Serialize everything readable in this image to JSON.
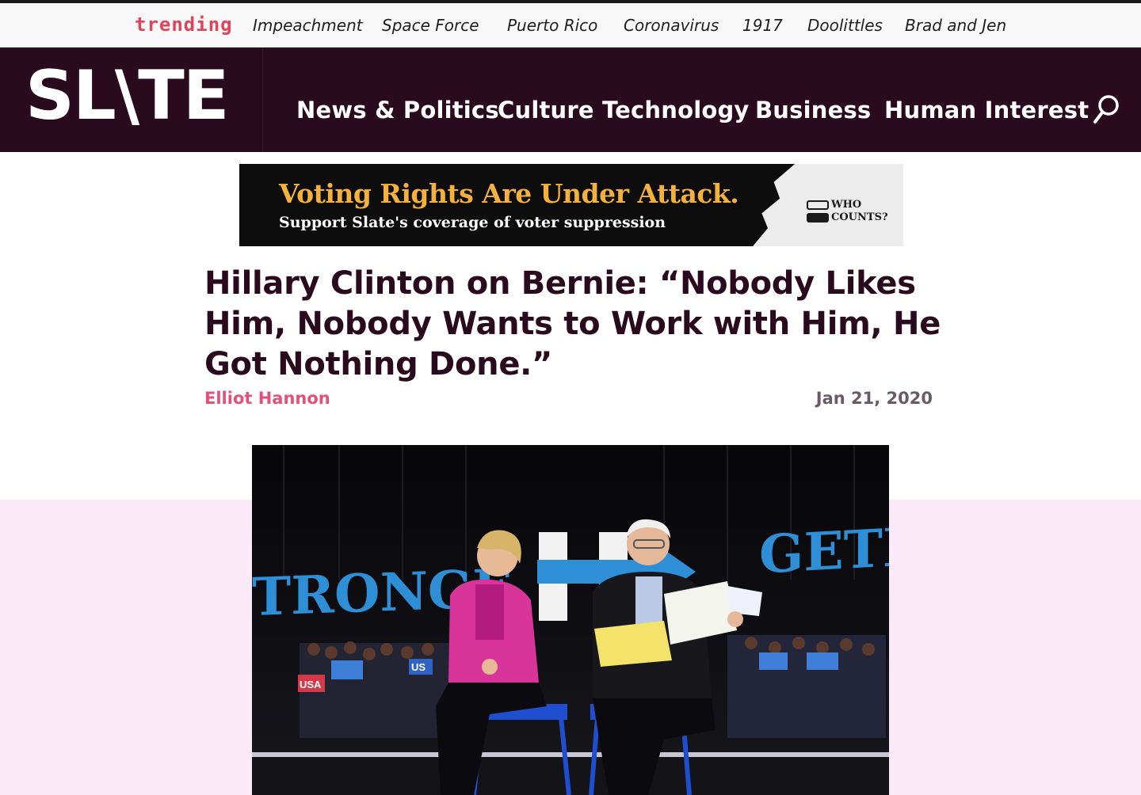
{
  "trending": {
    "label": "trending",
    "links": [
      "Impeachment",
      "Space Force",
      "Puerto Rico",
      "Coronavirus",
      "1917",
      "Doolittles",
      "Brad and Jen"
    ]
  },
  "header": {
    "logo": "SL\\TE",
    "nav": [
      "News & Politics",
      "Culture",
      "Technology",
      "Business",
      "Human Interest"
    ],
    "search_icon": "search-icon"
  },
  "ad": {
    "headline": "Voting Rights Are Under Attack.",
    "subline": "Support Slate's coverage of voter suppression",
    "badge_line1": "WHO",
    "badge_line2": "COUNTS?"
  },
  "article": {
    "title": "Hillary Clinton on Bernie: “Nobody Likes Him, Nobody Wants to Work with Him, He Got Nothing Done.”",
    "author": "Elliot Hannon",
    "date": "Jan 21, 2020"
  },
  "photo": {
    "banner_left": "TRONGE",
    "banner_right": "GETE",
    "sign_usa": "USA",
    "sign_us": "US"
  },
  "colors": {
    "brand_dark": "#2a0a1d",
    "trending_red": "#e0435a",
    "author_pink": "#e0527a",
    "ad_gold": "#f4b13c",
    "band_pink": "#faeaf8"
  }
}
